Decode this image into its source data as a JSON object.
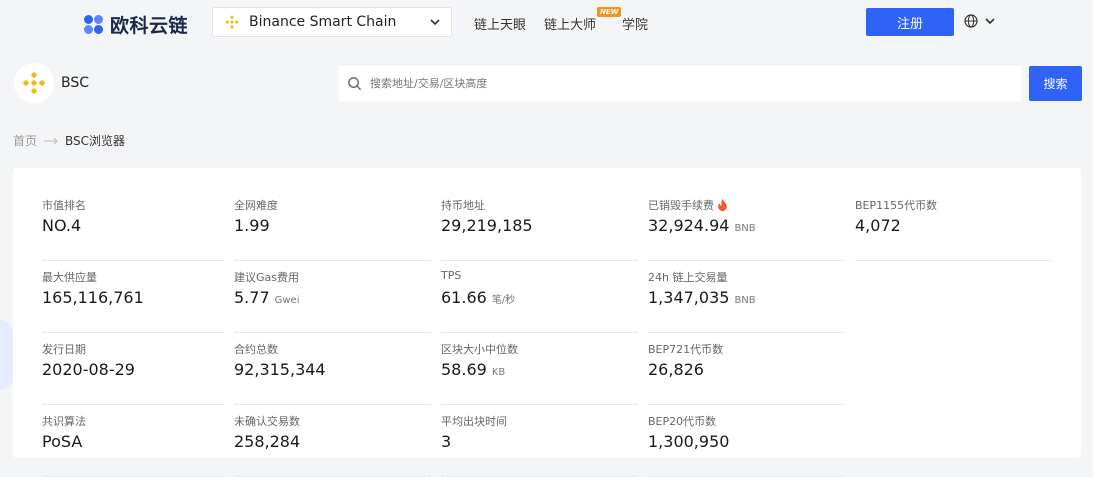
{
  "brand": {
    "name": "欧科云链"
  },
  "chain_selector": {
    "value": "Binance Smart Chain"
  },
  "nav": {
    "links": [
      "链上天眼",
      "链上大师",
      "学院"
    ],
    "new_badge": "NEW"
  },
  "auth": {
    "signup_label": "注册"
  },
  "explorer": {
    "chain_short": "BSC",
    "search_placeholder": "搜索地址/交易/区块高度",
    "search_button": "搜索"
  },
  "breadcrumb": {
    "home": "首页",
    "current": "BSC浏览器"
  },
  "stats": {
    "market_rank": {
      "label": "市值排名",
      "value": "NO.4"
    },
    "network_difficulty": {
      "label": "全网难度",
      "value": "1.99"
    },
    "holder_addresses": {
      "label": "持币地址",
      "value": "29,219,185"
    },
    "burned_fees": {
      "label": "已销毁手续费",
      "value": "32,924.94",
      "unit": "BNB"
    },
    "bep1155_tokens": {
      "label": "BEP1155代币数",
      "value": "4,072"
    },
    "max_supply": {
      "label": "最大供应量",
      "value": "165,116,761"
    },
    "suggested_gas": {
      "label": "建议Gas费用",
      "value": "5.77",
      "unit": "Gwei"
    },
    "tps": {
      "label": "TPS",
      "value": "61.66",
      "unit": "笔/秒"
    },
    "onchain_volume_24h": {
      "label": "24h 链上交易量",
      "value": "1,347,035",
      "unit": "BNB"
    },
    "issue_date": {
      "label": "发行日期",
      "value": "2020-08-29"
    },
    "total_contracts": {
      "label": "合约总数",
      "value": "92,315,344"
    },
    "block_size_median": {
      "label": "区块大小中位数",
      "value": "58.69",
      "unit": "KB"
    },
    "bep721_tokens": {
      "label": "BEP721代币数",
      "value": "26,826"
    },
    "consensus": {
      "label": "共识算法",
      "value": "PoSA"
    },
    "unconfirmed_tx": {
      "label": "未确认交易数",
      "value": "258,284"
    },
    "avg_block_time": {
      "label": "平均出块时间",
      "value": "3"
    },
    "bep20_tokens": {
      "label": "BEP20代币数",
      "value": "1,300,950"
    }
  },
  "colors": {
    "primary": "#2e63f6",
    "bnb": "#f0b90b",
    "fire": "#f5542e"
  }
}
